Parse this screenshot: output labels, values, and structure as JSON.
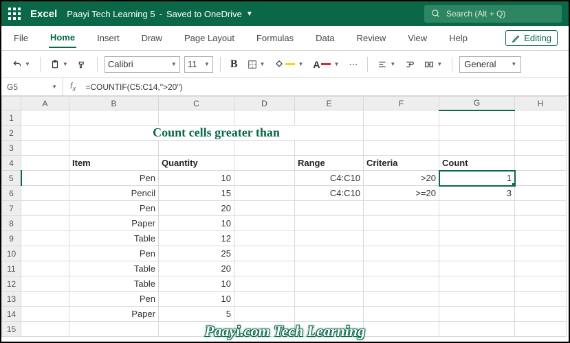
{
  "title": {
    "app": "Excel",
    "doc": "Paayi Tech Learning 5",
    "status": "Saved to OneDrive"
  },
  "search": {
    "placeholder": "Search (Alt + Q)"
  },
  "menu": {
    "file": "File",
    "home": "Home",
    "insert": "Insert",
    "draw": "Draw",
    "page": "Page Layout",
    "formulas": "Formulas",
    "data": "Data",
    "review": "Review",
    "view": "View",
    "help": "Help",
    "editing": "Editing"
  },
  "toolbar": {
    "font": "Calibri",
    "size": "11",
    "numfmt": "General"
  },
  "formula": {
    "name": "G5",
    "fx": "=COUNTIF(C5:C14,\">20\")"
  },
  "cols": {
    "A": "A",
    "B": "B",
    "C": "C",
    "D": "D",
    "E": "E",
    "F": "F",
    "G": "G",
    "H": "H"
  },
  "sheet_title": "Count cells greater than",
  "headers": {
    "item": "Item",
    "qty": "Quantity",
    "range": "Range",
    "crit": "Criteria",
    "count": "Count"
  },
  "rows": [
    {
      "n": "5",
      "item": "Pen",
      "qty": "10",
      "range": "C4:C10",
      "crit": ">20",
      "count": "1"
    },
    {
      "n": "6",
      "item": "Pencil",
      "qty": "15",
      "range": "C4:C10",
      "crit": ">=20",
      "count": "3"
    },
    {
      "n": "7",
      "item": "Pen",
      "qty": "20"
    },
    {
      "n": "8",
      "item": "Paper",
      "qty": "10"
    },
    {
      "n": "9",
      "item": "Table",
      "qty": "12"
    },
    {
      "n": "10",
      "item": "Pen",
      "qty": "25"
    },
    {
      "n": "11",
      "item": "Table",
      "qty": "20"
    },
    {
      "n": "12",
      "item": "Table",
      "qty": "10"
    },
    {
      "n": "13",
      "item": "Pen",
      "qty": "10"
    },
    {
      "n": "14",
      "item": "Paper",
      "qty": "5"
    }
  ],
  "chart_data": {
    "type": "table",
    "title": "Count cells greater than",
    "columns": [
      "Item",
      "Quantity",
      "Range",
      "Criteria",
      "Count"
    ],
    "data": [
      [
        "Pen",
        10,
        "C4:C10",
        ">20",
        1
      ],
      [
        "Pencil",
        15,
        "C4:C10",
        ">=20",
        3
      ],
      [
        "Pen",
        20,
        null,
        null,
        null
      ],
      [
        "Paper",
        10,
        null,
        null,
        null
      ],
      [
        "Table",
        12,
        null,
        null,
        null
      ],
      [
        "Pen",
        25,
        null,
        null,
        null
      ],
      [
        "Table",
        20,
        null,
        null,
        null
      ],
      [
        "Table",
        10,
        null,
        null,
        null
      ],
      [
        "Pen",
        10,
        null,
        null,
        null
      ],
      [
        "Paper",
        5,
        null,
        null,
        null
      ]
    ]
  },
  "watermark": "Paayi.com Tech Learning"
}
